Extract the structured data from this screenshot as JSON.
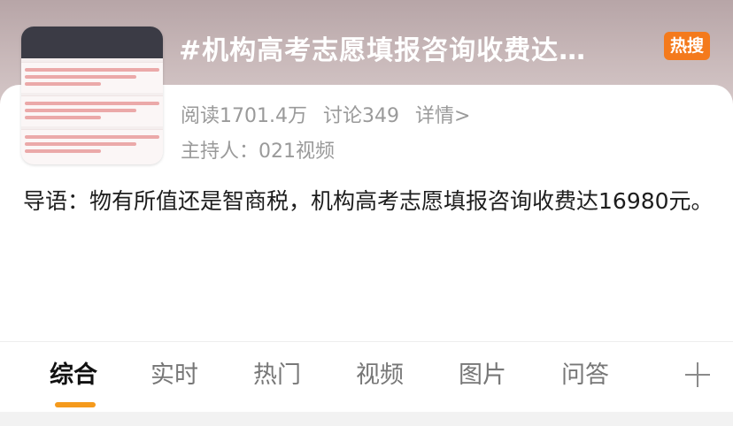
{
  "topic": {
    "title": "#机构高考志愿填报咨询收费达…",
    "badge": "热搜",
    "stats": {
      "reads": "阅读1701.4万",
      "discussions": "讨论349",
      "details": "详情>"
    },
    "host": "主持人：021视频",
    "intro": "导语：物有所值还是智商税，机构高考志愿填报咨询收费达16980元。"
  },
  "tabs": [
    {
      "label": "综合"
    },
    {
      "label": "实时"
    },
    {
      "label": "热门"
    },
    {
      "label": "视频"
    },
    {
      "label": "图片"
    },
    {
      "label": "问答"
    }
  ],
  "colors": {
    "badge": "#f47a1c",
    "active_underline": "#f59a1c",
    "header_bg": "#c9b9ba"
  },
  "icons": {
    "add_tab": "plus-icon"
  }
}
